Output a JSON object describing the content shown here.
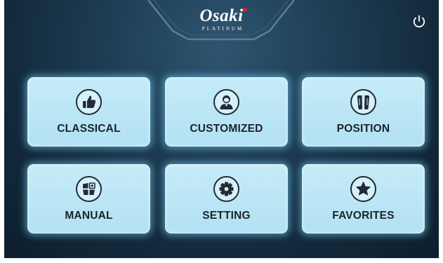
{
  "header": {
    "brand": "Osaki",
    "brand_sub": "PLATINUM"
  },
  "icons": {
    "power": "power-icon"
  },
  "menu": [
    {
      "id": "classical",
      "label": "CLASSICAL",
      "icon": "thumbs-up-icon"
    },
    {
      "id": "customized",
      "label": "CUSTOMIZED",
      "icon": "user-icon"
    },
    {
      "id": "position",
      "label": "POSITION",
      "icon": "massage-rollers-icon"
    },
    {
      "id": "manual",
      "label": "MANUAL",
      "icon": "grid-plus-icon"
    },
    {
      "id": "setting",
      "label": "SETTING",
      "icon": "gear-icon"
    },
    {
      "id": "favorites",
      "label": "FAVORITES",
      "icon": "star-icon"
    }
  ],
  "colors": {
    "background": "#1f3f56",
    "tile": "#b8e4f5",
    "tile_glow": "#78d2f5",
    "text_dark": "#1a232b",
    "brand_dot": "#e02424"
  }
}
